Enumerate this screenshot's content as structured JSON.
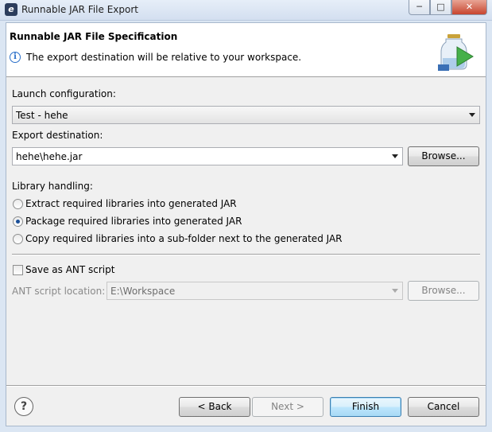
{
  "window": {
    "title": "Runnable JAR File Export",
    "minimize": "─",
    "maximize": "□",
    "close": "✕"
  },
  "header": {
    "title": "Runnable JAR File Specification",
    "message": "The export destination will be relative to your workspace."
  },
  "launch": {
    "label": "Launch configuration:",
    "value": "Test - hehe"
  },
  "export": {
    "label": "Export destination:",
    "value": "hehe\\hehe.jar",
    "browse": "Browse..."
  },
  "library": {
    "label": "Library handling:",
    "options": [
      {
        "label": "Extract required libraries into generated JAR",
        "checked": false
      },
      {
        "label": "Package required libraries into generated JAR",
        "checked": true
      },
      {
        "label": "Copy required libraries into a sub-folder next to the generated JAR",
        "checked": false
      }
    ]
  },
  "ant": {
    "save_label": "Save as ANT script",
    "checked": false,
    "location_label": "ANT script location:",
    "location_value": "E:\\Workspace",
    "browse": "Browse..."
  },
  "footer": {
    "back": "< Back",
    "next": "Next >",
    "finish": "Finish",
    "cancel": "Cancel"
  },
  "icons": {
    "app": "eclipse-icon",
    "info": "info-icon",
    "wizard": "jar-export-icon",
    "help": "help-icon"
  }
}
